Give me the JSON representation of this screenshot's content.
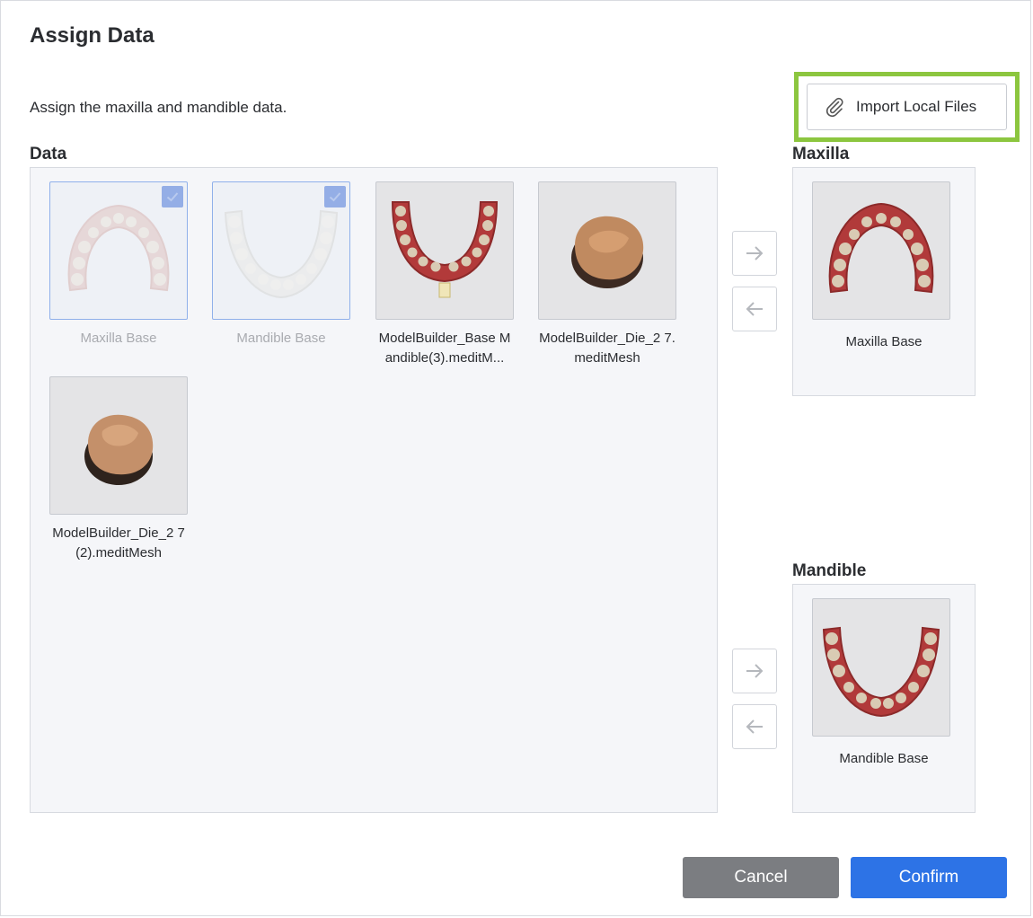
{
  "dialog": {
    "title": "Assign Data",
    "subtitle": "Assign the maxilla and mandible data.",
    "import_label": "Import Local Files"
  },
  "data_section": {
    "label": "Data",
    "items": [
      {
        "label": "Maxilla Base",
        "selected": true,
        "icon": "maxilla-arch"
      },
      {
        "label": "Mandible Base",
        "selected": true,
        "icon": "mandible-arch"
      },
      {
        "label": "ModelBuilder_Base Mandible(3).meditM...",
        "selected": false,
        "icon": "mandible-arch"
      },
      {
        "label": "ModelBuilder_Die_2 7.meditMesh",
        "selected": false,
        "icon": "tooth-die"
      },
      {
        "label": "ModelBuilder_Die_2 7(2).meditMesh",
        "selected": false,
        "icon": "tooth-die"
      }
    ]
  },
  "maxilla": {
    "label": "Maxilla",
    "assigned_label": "Maxilla Base"
  },
  "mandible": {
    "label": "Mandible",
    "assigned_label": "Mandible Base"
  },
  "footer": {
    "cancel_label": "Cancel",
    "confirm_label": "Confirm"
  },
  "colors": {
    "highlight": "#8cc63f",
    "confirm": "#2d73e6",
    "cancel": "#7b7d81",
    "check": "#94aee6"
  }
}
